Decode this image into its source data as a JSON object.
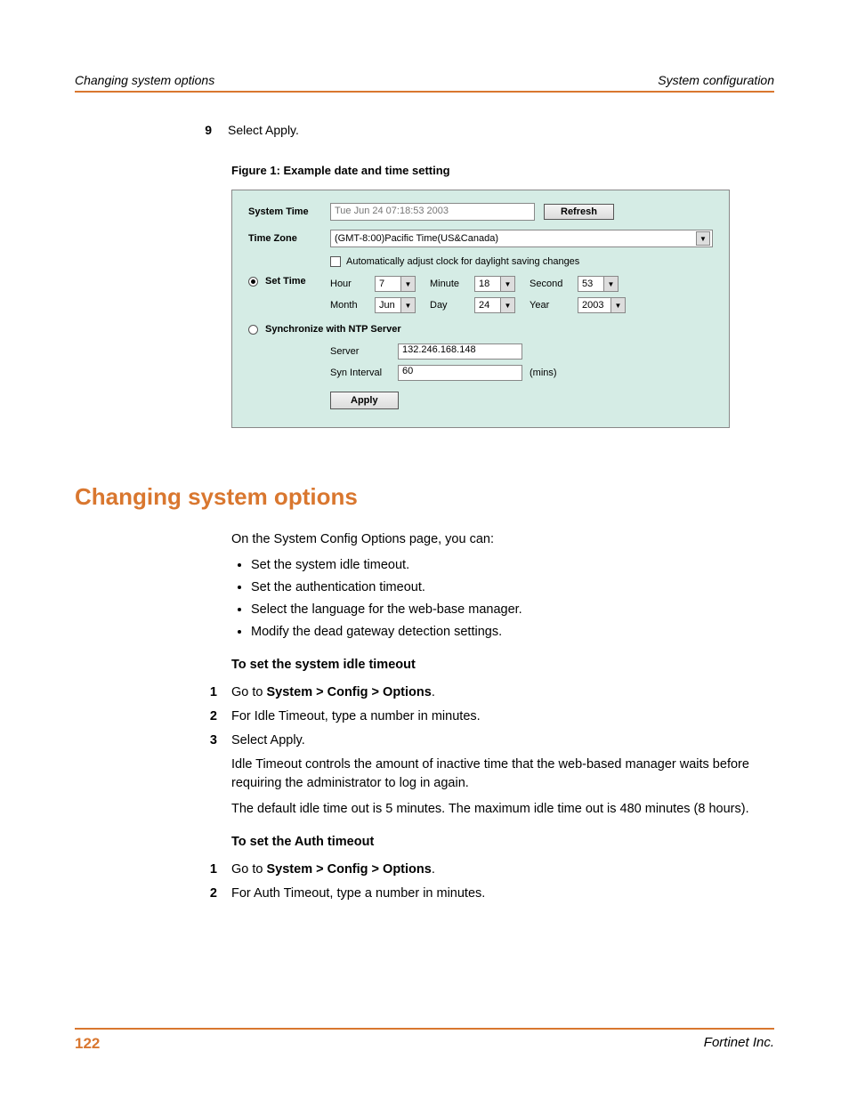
{
  "header": {
    "left": "Changing system options",
    "right": "System configuration"
  },
  "step9": {
    "num": "9",
    "text": "Select Apply."
  },
  "figure": {
    "caption": "Figure 1:   Example date and time setting"
  },
  "panel": {
    "systemTimeLabel": "System Time",
    "systemTimeValue": "Tue Jun 24 07:18:53 2003",
    "refresh": "Refresh",
    "timeZoneLabel": "Time Zone",
    "timeZoneValue": "(GMT-8:00)Pacific Time(US&Canada)",
    "dstLabel": "Automatically adjust clock for daylight saving changes",
    "setTimeLabel": "Set Time",
    "hourLabel": "Hour",
    "hour": "7",
    "minuteLabel": "Minute",
    "minute": "18",
    "secondLabel": "Second",
    "second": "53",
    "monthLabel": "Month",
    "month": "Jun",
    "dayLabel": "Day",
    "day": "24",
    "yearLabel": "Year",
    "year": "2003",
    "ntpLabel": "Synchronize with NTP Server",
    "serverLabel": "Server",
    "server": "132.246.168.148",
    "intervalLabel": "Syn Interval",
    "interval": "60",
    "intervalUnits": "(mins)",
    "apply": "Apply"
  },
  "sectionTitle": "Changing system options",
  "intro": "On the System Config Options page, you can:",
  "opts": [
    "Set the system idle timeout.",
    "Set the authentication timeout.",
    "Select the language for the web-base manager.",
    "Modify the dead gateway detection settings."
  ],
  "idle": {
    "heading": "To set the system idle timeout",
    "s1n": "1",
    "s1a": "Go to ",
    "s1b": "System > Config > Options",
    "s1c": ".",
    "s2n": "2",
    "s2": "For Idle Timeout, type a number in minutes.",
    "s3n": "3",
    "s3": "Select Apply.",
    "p1": "Idle Timeout controls the amount of inactive time that the web-based manager waits before requiring the administrator to log in again.",
    "p2": "The default idle time out is 5 minutes. The maximum idle time out is 480 minutes (8 hours)."
  },
  "auth": {
    "heading": "To set the Auth timeout",
    "s1n": "1",
    "s1a": "Go to ",
    "s1b": "System > Config > Options",
    "s1c": ".",
    "s2n": "2",
    "s2": "For Auth Timeout, type a number in minutes."
  },
  "footer": {
    "page": "122",
    "company": "Fortinet Inc."
  }
}
